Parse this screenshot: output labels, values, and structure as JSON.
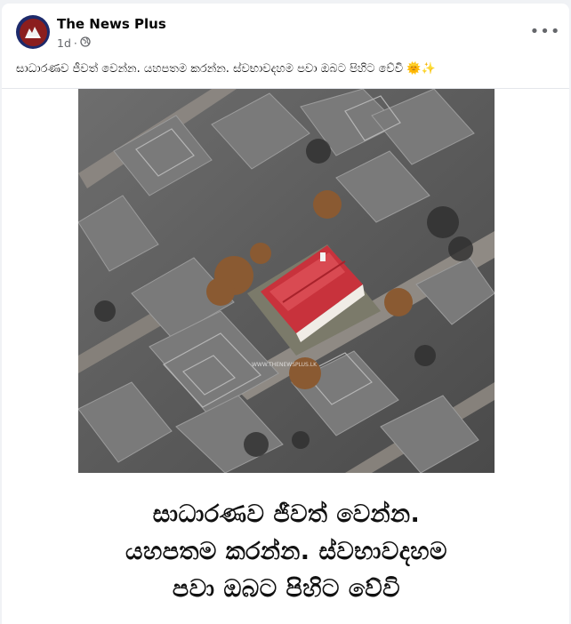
{
  "post": {
    "page_name": "The News Plus",
    "time": "1d",
    "separator": "·",
    "privacy_icon": "globe-icon",
    "more_label": "•••",
    "caption": "සාධාරණව ජීවත් වෙන්න. යහපතම කරන්න. ස්වභාවදහම පවා ඔබට පිහිට වේවි 🌞✨"
  },
  "image": {
    "watermark": "WWW.THENEWSPLUS.LK",
    "lines": [
      "සාධාරණව ජීවත් වෙන්න.",
      "යහපතම කරන්න. ස්වභාවදහම",
      "පවා ඔබට පිහිට වේවි"
    ]
  },
  "colors": {
    "accent": "#c8323c",
    "text": "#050505",
    "muted": "#65676b",
    "avatar_ring": "#1d2a6b",
    "avatar_fill": "#8b1e1e"
  }
}
